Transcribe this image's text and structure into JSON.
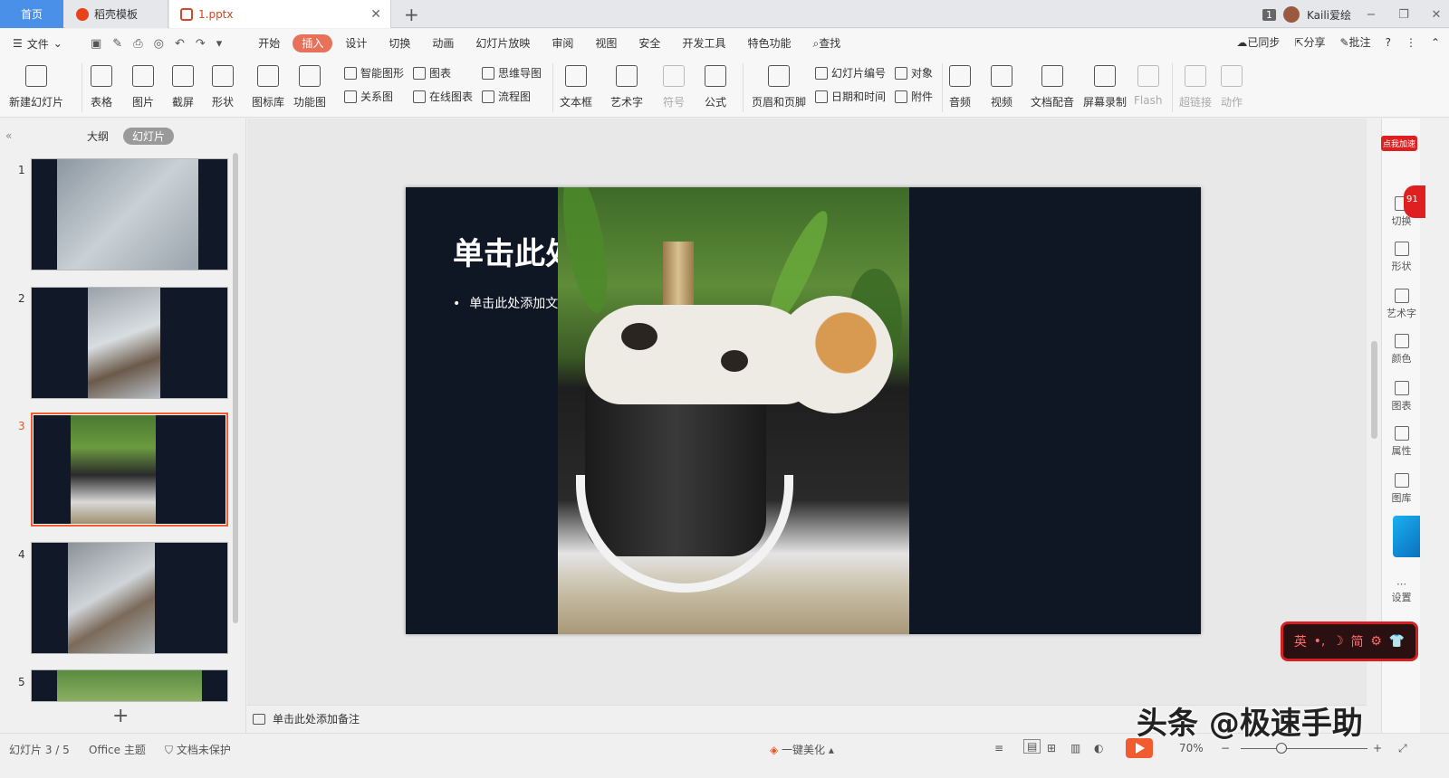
{
  "tabs": {
    "home": "首页",
    "templates": "稻壳模板",
    "file": "1.pptx",
    "add": "+"
  },
  "user": {
    "badge": "1",
    "name": "Kaili爱绘"
  },
  "window": {
    "minimize": "−",
    "restore": "❐",
    "close": "✕"
  },
  "menu": {
    "file": "文件",
    "tabs": [
      "开始",
      "插入",
      "设计",
      "切换",
      "动画",
      "幻灯片放映",
      "审阅",
      "视图",
      "安全",
      "开发工具",
      "特色功能",
      "查找"
    ],
    "active_index": 1,
    "right": {
      "sync": "已同步",
      "share": "分享",
      "comment": "批注",
      "help": "?"
    }
  },
  "ribbon": {
    "new_slide": "新建幻灯片",
    "table": "表格",
    "picture": "图片",
    "screenshot": "截屏",
    "shape": "形状",
    "icon_lib": "图标库",
    "func_chart": "功能图",
    "smart_shape": "智能图形",
    "chart": "图表",
    "relation": "关系图",
    "online_chart": "在线图表",
    "mindmap": "思维导图",
    "flowchart": "流程图",
    "textbox": "文本框",
    "wordart": "艺术字",
    "symbol": "符号",
    "formula": "公式",
    "header_footer": "页眉和页脚",
    "slide_number": "幻灯片编号",
    "object": "对象",
    "datetime": "日期和时间",
    "attachment": "附件",
    "audio": "音频",
    "video": "视频",
    "doc_voice": "文档配音",
    "screen_record": "屏幕录制",
    "flash": "Flash",
    "hyperlink": "超链接",
    "action": "动作"
  },
  "left_panel": {
    "outline": "大纲",
    "slides": "幻灯片",
    "thumbnails": [
      "1",
      "2",
      "3",
      "4",
      "5"
    ],
    "active_index": 2,
    "add": "+"
  },
  "slide": {
    "title": "单击此处",
    "bullet": "单击此处添加文"
  },
  "notes": {
    "placeholder": "单击此处添加备注"
  },
  "right_bar": {
    "promo": "点我加速",
    "bubble": "91",
    "items": [
      "切换",
      "形状",
      "艺术字",
      "颜色",
      "图表",
      "属性",
      "图库",
      "设置"
    ]
  },
  "ime": {
    "lang": "英",
    "mode": "简"
  },
  "status": {
    "slide_counter": "幻灯片 3 / 5",
    "theme": "Office 主题",
    "protection": "文档未保护",
    "beautify": "一键美化",
    "zoom": "70%",
    "zoom_minus": "−",
    "zoom_plus": "+"
  },
  "watermark": "头条 @极速手助",
  "colors": {
    "accent": "#e8715a",
    "home_tab": "#4a8fe8",
    "slide_bg": "#0f1624",
    "active_border": "#f25a30"
  }
}
